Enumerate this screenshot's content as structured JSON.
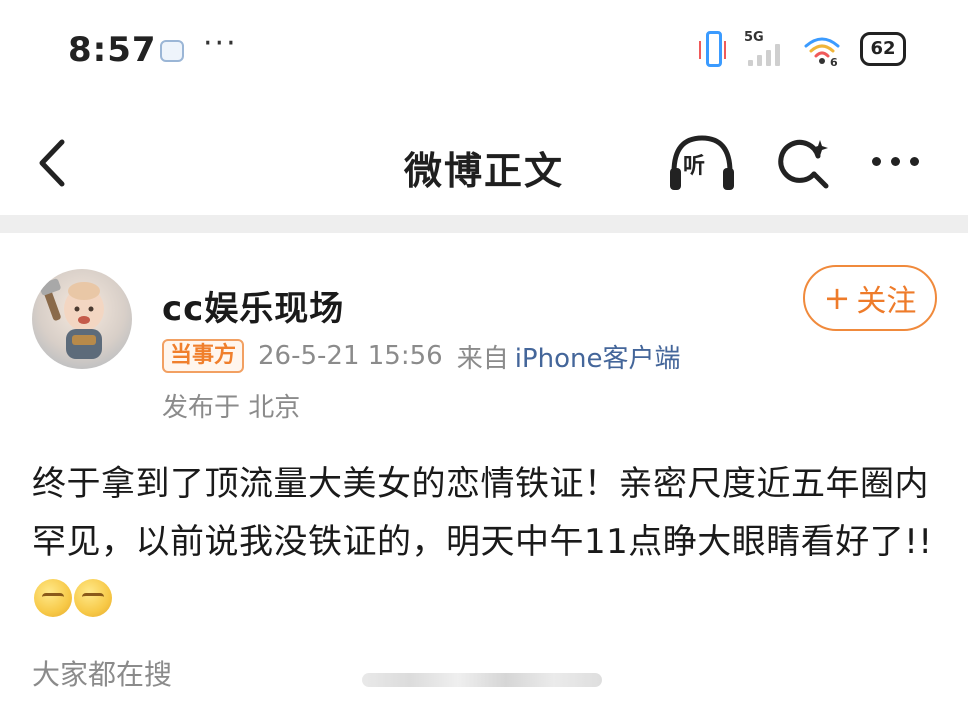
{
  "status_bar": {
    "time": "8:57",
    "more": "···",
    "network_label": "5G",
    "wifi_badge": "6",
    "battery": "62"
  },
  "nav": {
    "title": "微博正文",
    "listen_label": "听"
  },
  "post": {
    "author": "cc娱乐现场",
    "follow_label": "关注",
    "tag": "当事方",
    "date": "26-5-21 15:56",
    "source_prefix": "来自",
    "source": "iPhone客户端",
    "location": "发布于 北京",
    "content": "终于拿到了顶流量大美女的恋情铁证！亲密尺度近五年圈内罕见，以前说我没铁证的，明天中午11点睁大眼睛看好了!!",
    "emojis": [
      "thinking-emoji",
      "thinking-emoji"
    ],
    "hot_search_label": "大家都在搜"
  },
  "colors": {
    "accent_orange": "#ee7b2a",
    "link_blue": "#44669a",
    "meta_gray": "#8b8b8b"
  }
}
